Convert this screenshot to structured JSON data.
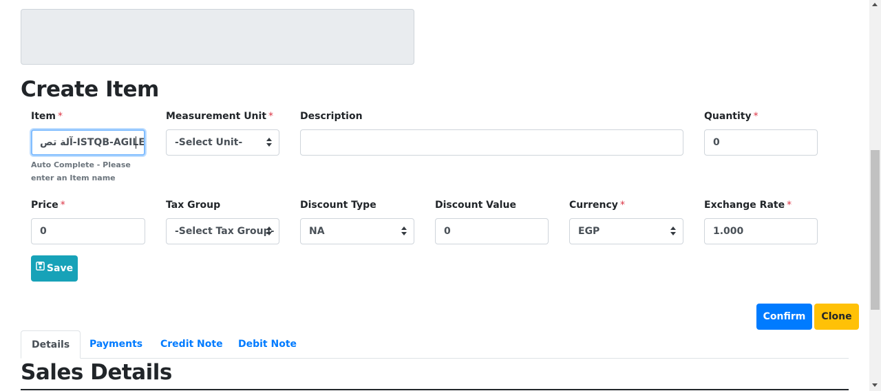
{
  "page_title": "Create Item",
  "form": {
    "item": {
      "label": "Item",
      "required": "*",
      "value": "آلة تص-ISTQB-AGILE",
      "hint": "Auto Complete - Please enter an Item name"
    },
    "measurement_unit": {
      "label": "Measurement Unit",
      "required": "*",
      "value": "-Select Unit-"
    },
    "description": {
      "label": "Description",
      "value": ""
    },
    "quantity": {
      "label": "Quantity",
      "required": "*",
      "value": "0"
    },
    "price": {
      "label": "Price",
      "required": "*",
      "value": "0"
    },
    "tax_group": {
      "label": "Tax Group",
      "value": "-Select Tax Group-"
    },
    "discount_type": {
      "label": "Discount Type",
      "value": "NA"
    },
    "discount_value": {
      "label": "Discount Value",
      "value": "0"
    },
    "currency": {
      "label": "Currency",
      "required": "*",
      "value": "EGP"
    },
    "exchange_rate": {
      "label": "Exchange Rate",
      "required": "*",
      "value": "1.000"
    },
    "save_label": "Save"
  },
  "actions": {
    "confirm_label": "Confirm",
    "clone_label": "Clone"
  },
  "tabs": [
    {
      "label": "Details",
      "active": true
    },
    {
      "label": "Payments"
    },
    {
      "label": "Credit Note"
    },
    {
      "label": "Debit Note"
    }
  ],
  "section_title": "Sales Details",
  "colors": {
    "primary": "#007bff",
    "info": "#17a2b8",
    "warning": "#ffc107",
    "danger": "#dc3545"
  },
  "icons": {
    "save": "floppy-disk-icon",
    "select": "chevron-updown-icon"
  }
}
